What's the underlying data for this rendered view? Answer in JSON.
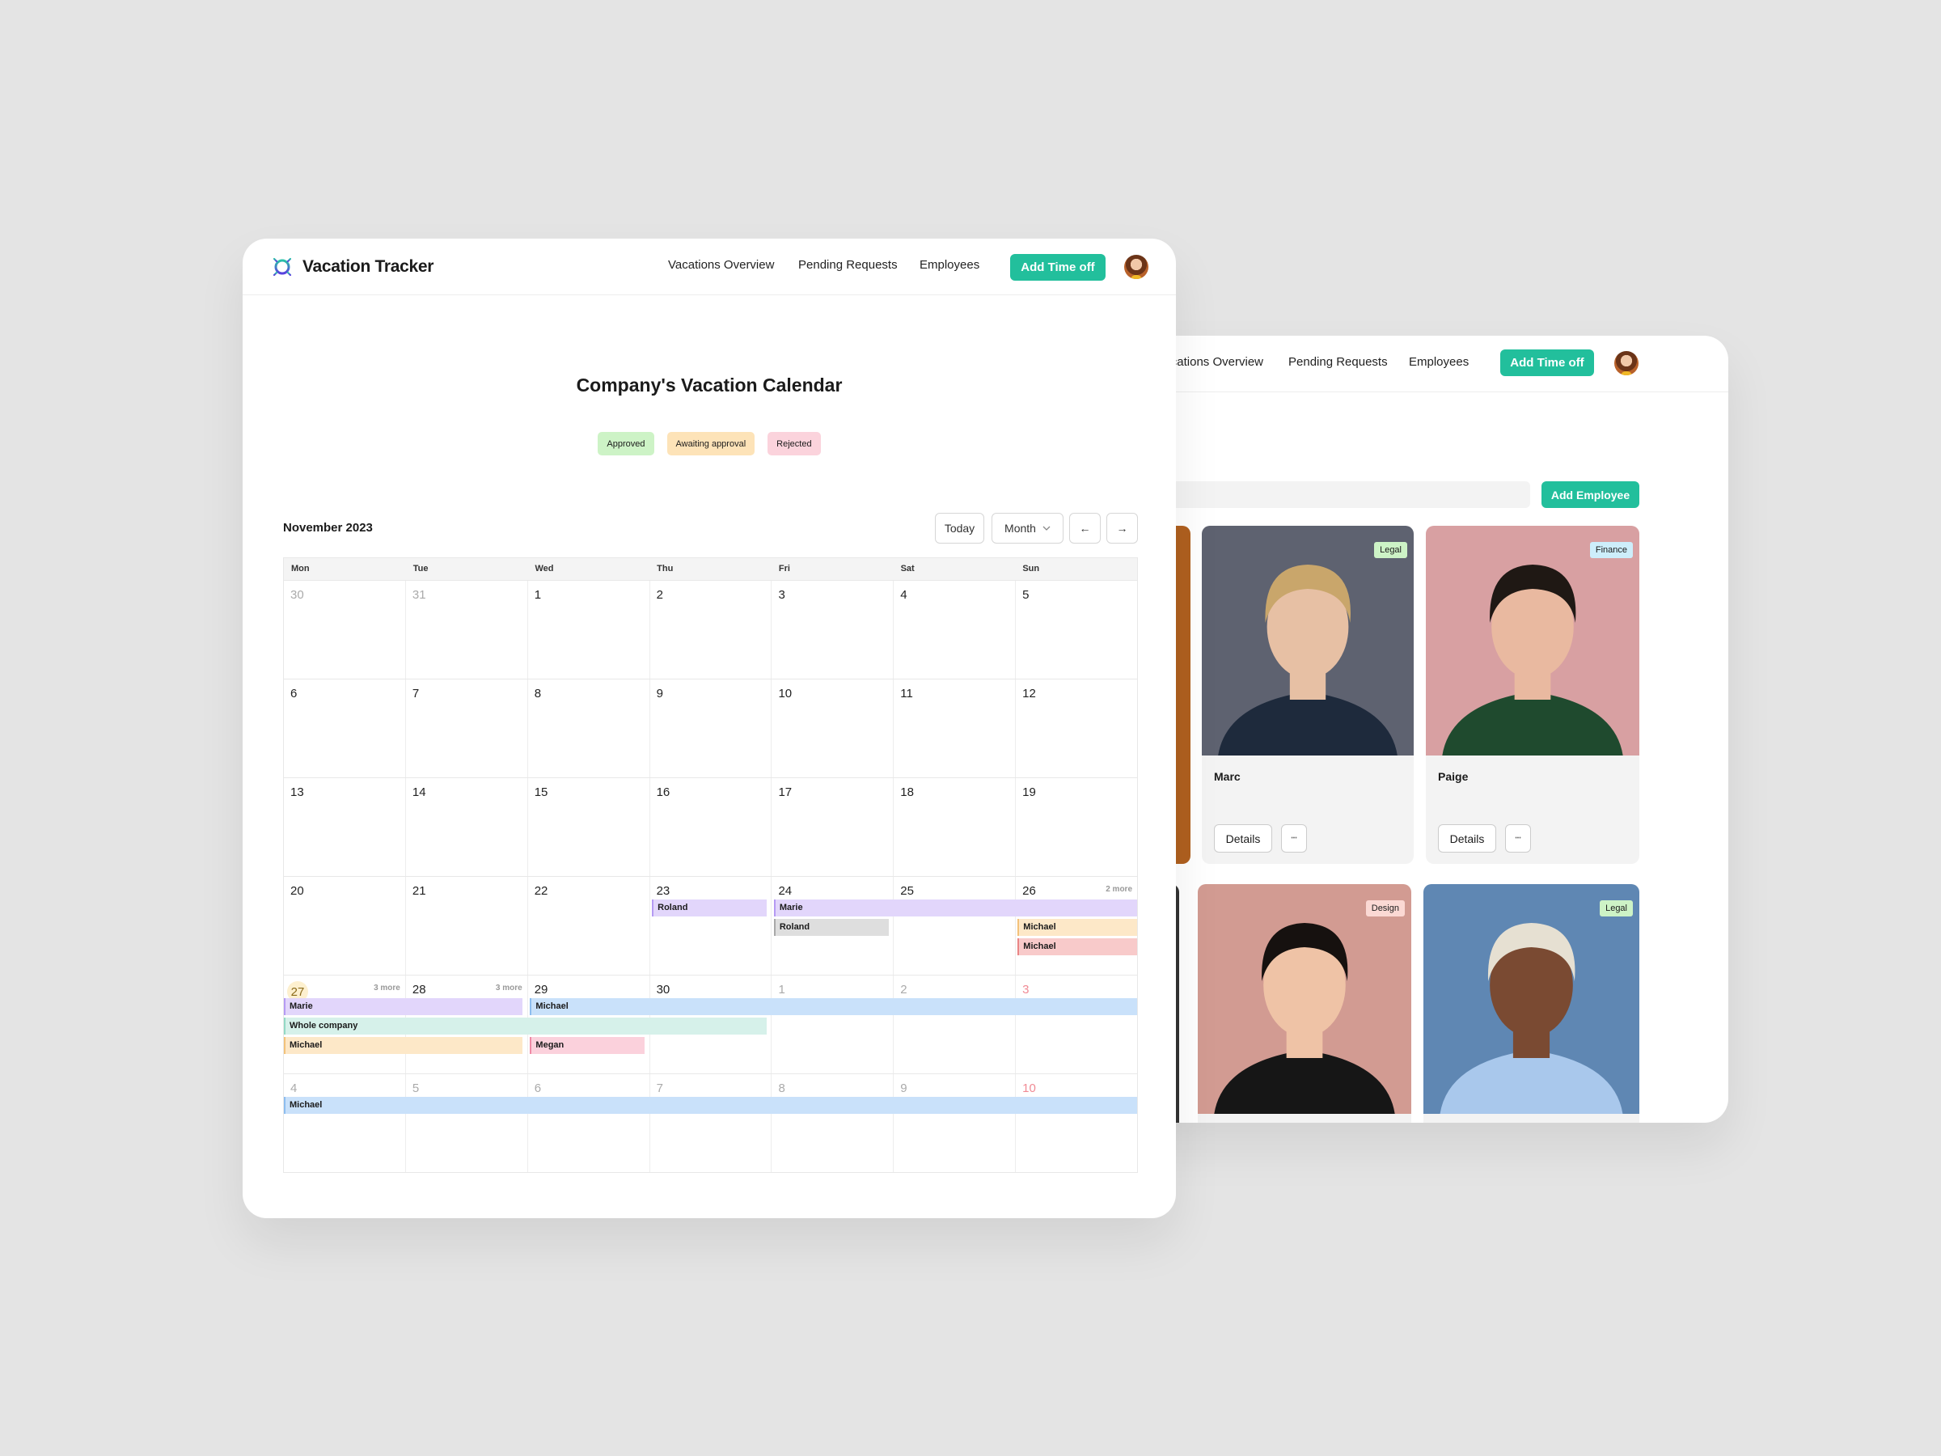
{
  "app": {
    "name": "Vacation Tracker",
    "logo_icon": "sun-gear-icon"
  },
  "nav": {
    "items": [
      "Vacations Overview",
      "Pending Requests",
      "Employees"
    ],
    "cta": "Add Time off",
    "avatar": "user-avatar"
  },
  "colors": {
    "accent": "#22bf9c",
    "background": "#e4e4e4"
  },
  "calendar": {
    "title": "Company's Vacation Calendar",
    "legend": [
      {
        "label": "Approved",
        "bg": "#cdf3c6"
      },
      {
        "label": "Awaiting approval",
        "bg": "#fde3b8"
      },
      {
        "label": "Rejected",
        "bg": "#fbd3dc"
      }
    ],
    "month_label": "November 2023",
    "controls": {
      "today": "Today",
      "view": "Month",
      "prev": "←",
      "next": "→"
    },
    "weekdays": [
      "Mon",
      "Tue",
      "Wed",
      "Thu",
      "Fri",
      "Sat",
      "Sun"
    ],
    "weeks": [
      {
        "days": [
          {
            "d": "30",
            "muted": true
          },
          {
            "d": "31",
            "muted": true
          },
          {
            "d": "1"
          },
          {
            "d": "2"
          },
          {
            "d": "3"
          },
          {
            "d": "4"
          },
          {
            "d": "5"
          }
        ]
      },
      {
        "days": [
          {
            "d": "6"
          },
          {
            "d": "7"
          },
          {
            "d": "8"
          },
          {
            "d": "9"
          },
          {
            "d": "10"
          },
          {
            "d": "11"
          },
          {
            "d": "12"
          }
        ]
      },
      {
        "days": [
          {
            "d": "13"
          },
          {
            "d": "14"
          },
          {
            "d": "15"
          },
          {
            "d": "16"
          },
          {
            "d": "17"
          },
          {
            "d": "18"
          },
          {
            "d": "19"
          }
        ]
      },
      {
        "days": [
          {
            "d": "20"
          },
          {
            "d": "21"
          },
          {
            "d": "22"
          },
          {
            "d": "23"
          },
          {
            "d": "24"
          },
          {
            "d": "25"
          },
          {
            "d": "26",
            "more": "2 more"
          }
        ]
      },
      {
        "days": [
          {
            "d": "27",
            "today": true,
            "more": "3 more"
          },
          {
            "d": "28",
            "more": "3 more"
          },
          {
            "d": "29"
          },
          {
            "d": "30"
          },
          {
            "d": "1",
            "muted": true
          },
          {
            "d": "2",
            "muted": true
          },
          {
            "d": "3",
            "red": true
          }
        ]
      },
      {
        "days": [
          {
            "d": "4",
            "muted": true
          },
          {
            "d": "5",
            "muted": true
          },
          {
            "d": "6",
            "muted": true
          },
          {
            "d": "7",
            "muted": true
          },
          {
            "d": "8",
            "muted": true
          },
          {
            "d": "9",
            "muted": true
          },
          {
            "d": "10",
            "red": true
          }
        ]
      }
    ],
    "events": [
      {
        "label": "Roland",
        "week": 3,
        "from": "Thu",
        "to": "Thu",
        "lane": 0,
        "bg": "#e2d6fb",
        "border": "#b59af3"
      },
      {
        "label": "Marie",
        "week": 3,
        "from": "Fri",
        "to": "Sun",
        "lane": 0,
        "bg": "#e2d6fb",
        "border": "#b59af3"
      },
      {
        "label": "Roland",
        "week": 3,
        "from": "Fri",
        "to": "Fri",
        "lane": 1,
        "bg": "#dedede",
        "border": "#a8a8a8"
      },
      {
        "label": "Michael",
        "week": 3,
        "from": "Sun",
        "to": "Sun",
        "lane": 1,
        "bg": "#fde8c8",
        "border": "#f3c27a"
      },
      {
        "label": "Michael",
        "week": 3,
        "from": "Sun",
        "to": "Sun",
        "lane": 2,
        "bg": "#f8caca",
        "border": "#ea8585"
      },
      {
        "label": "Marie",
        "week": 4,
        "from": "Mon",
        "to": "Tue",
        "lane": 0,
        "bg": "#e2d6fb",
        "border": "#b59af3"
      },
      {
        "label": "Michael",
        "week": 4,
        "from": "Wed",
        "to": "Sun",
        "lane": 0,
        "bg": "#c9e1fa",
        "border": "#8dbdef"
      },
      {
        "label": "Whole company",
        "week": 4,
        "from": "Mon",
        "to": "Thu",
        "lane": 1,
        "bg": "#d6f1ea",
        "border": "#93d9c5"
      },
      {
        "label": "Michael",
        "week": 4,
        "from": "Mon",
        "to": "Tue",
        "lane": 2,
        "bg": "#fde8c8",
        "border": "#f3c27a"
      },
      {
        "label": "Megan",
        "week": 4,
        "from": "Wed",
        "to": "Wed",
        "lane": 2,
        "bg": "#fbd1dc",
        "border": "#ef8aa5"
      },
      {
        "label": "Michael",
        "week": 5,
        "from": "Mon",
        "to": "Sun",
        "lane": 0,
        "bg": "#c9e1fa",
        "border": "#8dbdef"
      }
    ]
  },
  "employees": {
    "add_label": "Add Employee",
    "details_label": "Details",
    "more_icon": "ellipsis-icon",
    "cards": [
      {
        "name": "Marc",
        "tag": "Legal",
        "tag_bg": "#cdf3c6",
        "photo_bg": "#5e6270",
        "skin": "#e7c0a4",
        "hair": "#c9a66b",
        "shirt": "#1e2a3c"
      },
      {
        "name": "Paige",
        "tag": "Finance",
        "tag_bg": "#cdeefb",
        "photo_bg": "#d8a0a2",
        "skin": "#e9b9a0",
        "hair": "#1f1814",
        "shirt": "#1f4a2e"
      },
      {
        "name": "",
        "tag": "Design",
        "tag_bg": "#fbd9d4",
        "photo_bg": "#d29b92",
        "skin": "#efc3a6",
        "hair": "#16110f",
        "shirt": "#161616"
      },
      {
        "name": "",
        "tag": "Legal",
        "tag_bg": "#cdf3c6",
        "photo_bg": "#5f87b3",
        "skin": "#7a4a32",
        "hair": "#e6e0d2",
        "shirt": "#a9c8ec"
      }
    ]
  }
}
